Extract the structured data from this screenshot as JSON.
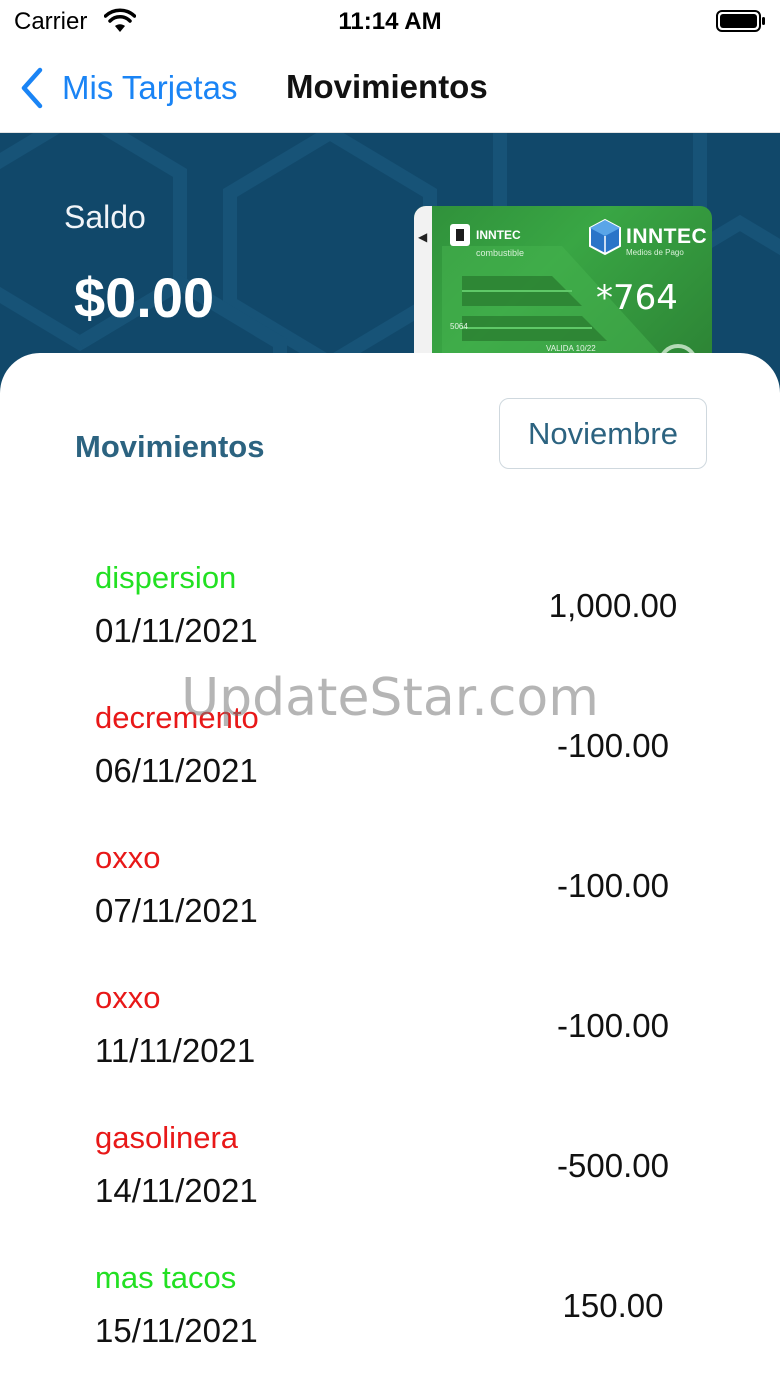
{
  "status_bar": {
    "carrier": "Carrier",
    "time": "11:14 AM"
  },
  "nav": {
    "back_label": "Mis Tarjetas",
    "title": "Movimientos"
  },
  "balance": {
    "label": "Saldo",
    "amount": "$0.00"
  },
  "card": {
    "brand_left": "INNTEC",
    "brand_left_sub": "combustible",
    "brand_right": "INNTEC",
    "brand_right_tag": "Medios de Pago",
    "number": "*764",
    "small_digits": "5064",
    "valid_label": "VALIDA 10/22",
    "color": "#2f8f3a"
  },
  "movements": {
    "section_title": "Movimientos",
    "month_selector": "Noviembre",
    "income_color": "#22e022",
    "expense_color": "#e81818",
    "items": [
      {
        "concept": "dispersion",
        "date": "01/11/2021",
        "amount": "1,000.00",
        "type": "income"
      },
      {
        "concept": "decremento",
        "date": "06/11/2021",
        "amount": "-100.00",
        "type": "expense"
      },
      {
        "concept": "oxxo",
        "date": "07/11/2021",
        "amount": "-100.00",
        "type": "expense"
      },
      {
        "concept": "oxxo",
        "date": "11/11/2021",
        "amount": "-100.00",
        "type": "expense"
      },
      {
        "concept": "gasolinera",
        "date": "14/11/2021",
        "amount": "-500.00",
        "type": "expense"
      },
      {
        "concept": "mas tacos",
        "date": "15/11/2021",
        "amount": "150.00",
        "type": "income"
      }
    ]
  },
  "watermark": "UpdateStar.com",
  "colors": {
    "header_bg": "#11486a",
    "link_blue": "#1a84f5",
    "title_teal": "#2c6380"
  }
}
